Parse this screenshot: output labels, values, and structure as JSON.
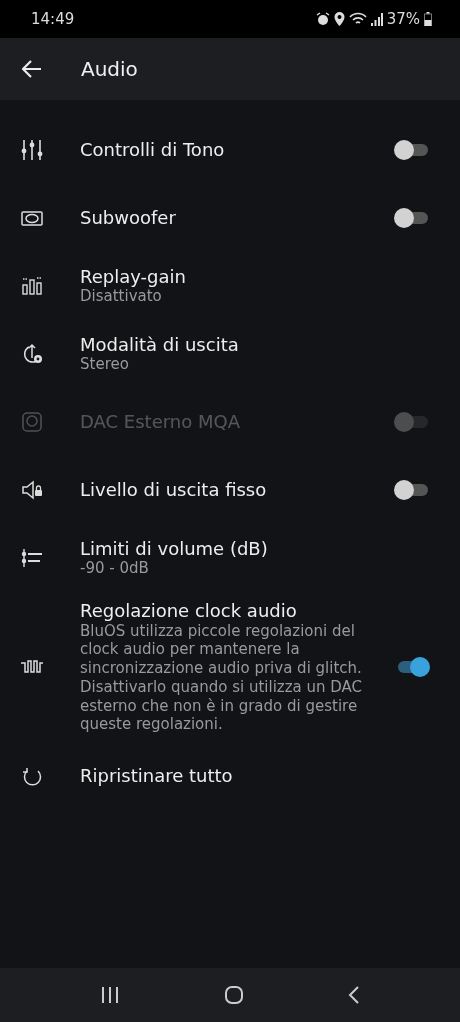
{
  "status_bar": {
    "time": "14:49",
    "battery": "37%"
  },
  "app_bar": {
    "title": "Audio"
  },
  "settings": [
    {
      "kind": "sliders",
      "title": "Controlli di Tono",
      "on": false,
      "disabled": false
    },
    {
      "kind": "speaker",
      "title": "Subwoofer",
      "on": false,
      "disabled": false
    },
    {
      "kind": "meters",
      "title": "Replay-gain",
      "subtitle": "Disattivato",
      "disabled": false
    },
    {
      "kind": "output",
      "title": "Modalità di uscita",
      "subtitle": "Stereo",
      "disabled": false
    },
    {
      "kind": "dac",
      "title": "DAC Esterno MQA",
      "on": false,
      "disabled": true
    },
    {
      "kind": "lock",
      "title": "Livello di uscita fisso",
      "on": false,
      "disabled": false
    },
    {
      "kind": "limits",
      "title": "Limiti di volume (dB)",
      "subtitle": "-90 - 0dB",
      "disabled": false
    },
    {
      "kind": "clock",
      "title": "Regolazione clock audio",
      "subtitle": "BluOS utilizza piccole regolazioni del clock audio per mantenere la sincronizzazione audio priva di glitch. Disattivarlo quando si utilizza un DAC esterno che non è in grado di gestire queste regolazioni.",
      "on": true,
      "disabled": false
    },
    {
      "kind": "reset",
      "title": "Ripristinare tutto",
      "disabled": false
    }
  ]
}
